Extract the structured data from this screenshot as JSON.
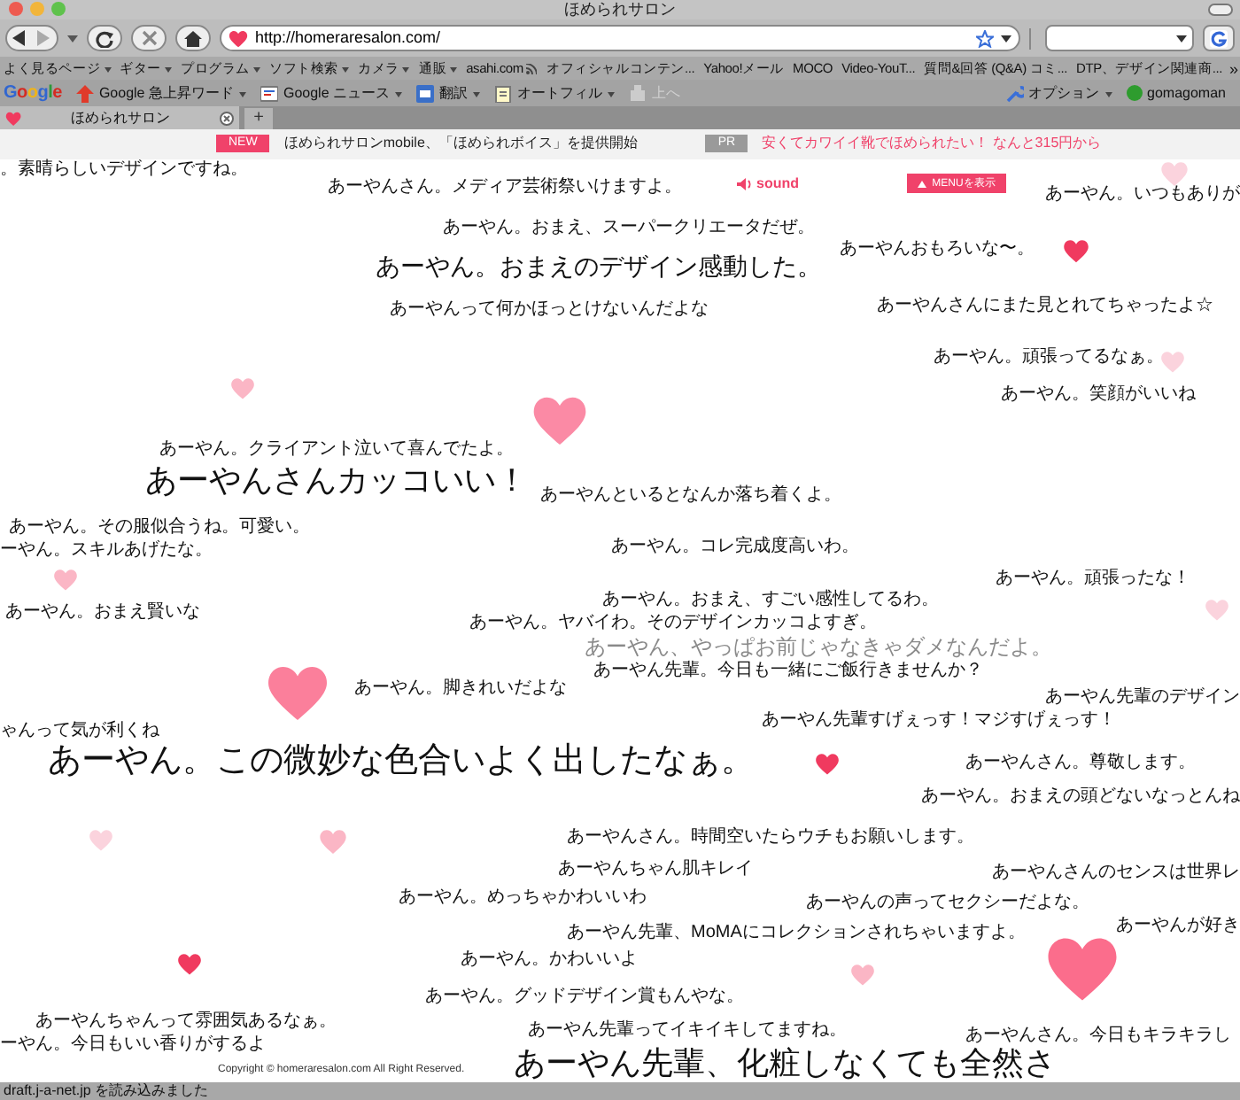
{
  "window": {
    "title": "ほめられサロン"
  },
  "address_bar": {
    "url": "http://homeraresalon.com/"
  },
  "bookmarks": [
    {
      "label": "よく見るページ",
      "kind": "folder"
    },
    {
      "label": "ギター",
      "kind": "folder"
    },
    {
      "label": "プログラム",
      "kind": "folder"
    },
    {
      "label": "ソフト検索",
      "kind": "folder"
    },
    {
      "label": "カメラ",
      "kind": "folder"
    },
    {
      "label": "通販",
      "kind": "folder"
    },
    {
      "label": "asahi.com",
      "kind": "feed"
    },
    {
      "label": "オフィシャルコンテン...",
      "kind": "link"
    },
    {
      "label": "Yahoo!メール",
      "kind": "link"
    },
    {
      "label": "MOCO",
      "kind": "link"
    },
    {
      "label": "Video-YouT...",
      "kind": "link"
    },
    {
      "label": "質問&回答 (Q&A) コミ...",
      "kind": "link"
    },
    {
      "label": "DTP、デザイン関連商...",
      "kind": "link"
    }
  ],
  "bookmarks_more": "»",
  "google_toolbar": {
    "logo": "Google",
    "items": [
      {
        "label": "Google 急上昇ワード",
        "disabled": false
      },
      {
        "label": "Google ニュース",
        "disabled": false
      },
      {
        "label": "翻訳",
        "disabled": false
      },
      {
        "label": "オートフィル",
        "disabled": false
      },
      {
        "label": "上へ",
        "disabled": true
      }
    ],
    "options": "オプション",
    "user": "gomagoman"
  },
  "tabs": [
    {
      "label": "ほめられサロン",
      "selected": true
    }
  ],
  "new_tab": "+",
  "announcement": {
    "badge": "NEW",
    "text": "ほめられサロンmobile、「ほめられボイス」を提供開始",
    "pr_badge": "PR",
    "pr_text": "安くてカワイイ靴でほめられたい！ なんと315円から"
  },
  "header": {
    "sound": "sound",
    "menu_button": "MENUを表示"
  },
  "messages": [
    {
      "text": "。素晴らしいデザインですね。",
      "kind": "small"
    },
    {
      "text": "あーやんさん。メディア芸術祭いけますよ。",
      "kind": "small"
    },
    {
      "text": "あーやん。いつもありが",
      "kind": "small"
    },
    {
      "text": "あーやん。おまえ、スーパークリエータだぜ。",
      "kind": "small"
    },
    {
      "text": "あーやんおもろいな〜。",
      "kind": "small"
    },
    {
      "text": "あーやん。おまえのデザイン感動した。",
      "kind": "large"
    },
    {
      "text": "あーやんって何かほっとけないんだよな",
      "kind": "small"
    },
    {
      "text": "あーやんさんにまた見とれてちゃったよ☆",
      "kind": "small"
    },
    {
      "text": "あーやん。頑張ってるなぁ。",
      "kind": "small"
    },
    {
      "text": "あーやん。笑顔がいいね",
      "kind": "small"
    },
    {
      "text": "あーやん。クライアント泣いて喜んでたよ。",
      "kind": "small"
    },
    {
      "text": "あーやんさんカッコいい！",
      "kind": "large"
    },
    {
      "text": "あーやんといるとなんか落ち着くよ。",
      "kind": "small"
    },
    {
      "text": "あーやん。その服似合うね。可愛い。",
      "kind": "small"
    },
    {
      "text": "ーやん。スキルあげたな。",
      "kind": "small"
    },
    {
      "text": "あーやん。コレ完成度高いわ。",
      "kind": "small"
    },
    {
      "text": "あーやん。頑張ったな！",
      "kind": "small"
    },
    {
      "text": "あーやん。おまえ、すごい感性してるわ。",
      "kind": "small"
    },
    {
      "text": "あーやん。おまえ賢いな",
      "kind": "small"
    },
    {
      "text": "あーやん。ヤバイわ。そのデザインカッコよすぎ。",
      "kind": "small"
    },
    {
      "text": "あーやん、やっぱお前じゃなきゃダメなんだよ。",
      "kind": "faded"
    },
    {
      "text": "あーやん先輩。今日も一緒にご飯行きませんか？",
      "kind": "small"
    },
    {
      "text": "あーやん。脚きれいだよな",
      "kind": "small"
    },
    {
      "text": "あーやん先輩のデザイン",
      "kind": "small"
    },
    {
      "text": "あーやん先輩すげぇっす！マジすげぇっす！",
      "kind": "small"
    },
    {
      "text": "ゃんって気が利くね",
      "kind": "small"
    },
    {
      "text": "あーやん。この微妙な色合いよく出したなぁ。",
      "kind": "large"
    },
    {
      "text": "あーやんさん。尊敬します。",
      "kind": "small"
    },
    {
      "text": "あーやん。おまえの頭どないなっとんね",
      "kind": "small"
    },
    {
      "text": "あーやんさん。時間空いたらウチもお願いします。",
      "kind": "small"
    },
    {
      "text": "あーやんちゃん肌キレイ",
      "kind": "small"
    },
    {
      "text": "あーやんさんのセンスは世界レ",
      "kind": "small"
    },
    {
      "text": "あーやん。めっちゃかわいいわ",
      "kind": "small"
    },
    {
      "text": "あーやんの声ってセクシーだよな。",
      "kind": "small"
    },
    {
      "text": "あーやん先輩、MoMAにコレクションされちゃいますよ。",
      "kind": "small"
    },
    {
      "text": "あーやんが好き",
      "kind": "small"
    },
    {
      "text": "あーやん。かわいいよ",
      "kind": "small"
    },
    {
      "text": "あーやん。グッドデザイン賞もんやな。",
      "kind": "small"
    },
    {
      "text": "あーやんちゃんって雰囲気あるなぁ。",
      "kind": "small"
    },
    {
      "text": "ーやん。今日もいい香りがするよ",
      "kind": "small"
    },
    {
      "text": "あーやん先輩ってイキイキしてますね。",
      "kind": "small"
    },
    {
      "text": "あーやんさん。今日もキラキラし",
      "kind": "small"
    },
    {
      "text": "あーやん先輩、化粧しなくても全然さ",
      "kind": "large"
    }
  ],
  "copyright": "Copyright © homeraresalon.com All Right Reserved.",
  "status_bar": "draft.j-a-net.jp を読み込みました"
}
